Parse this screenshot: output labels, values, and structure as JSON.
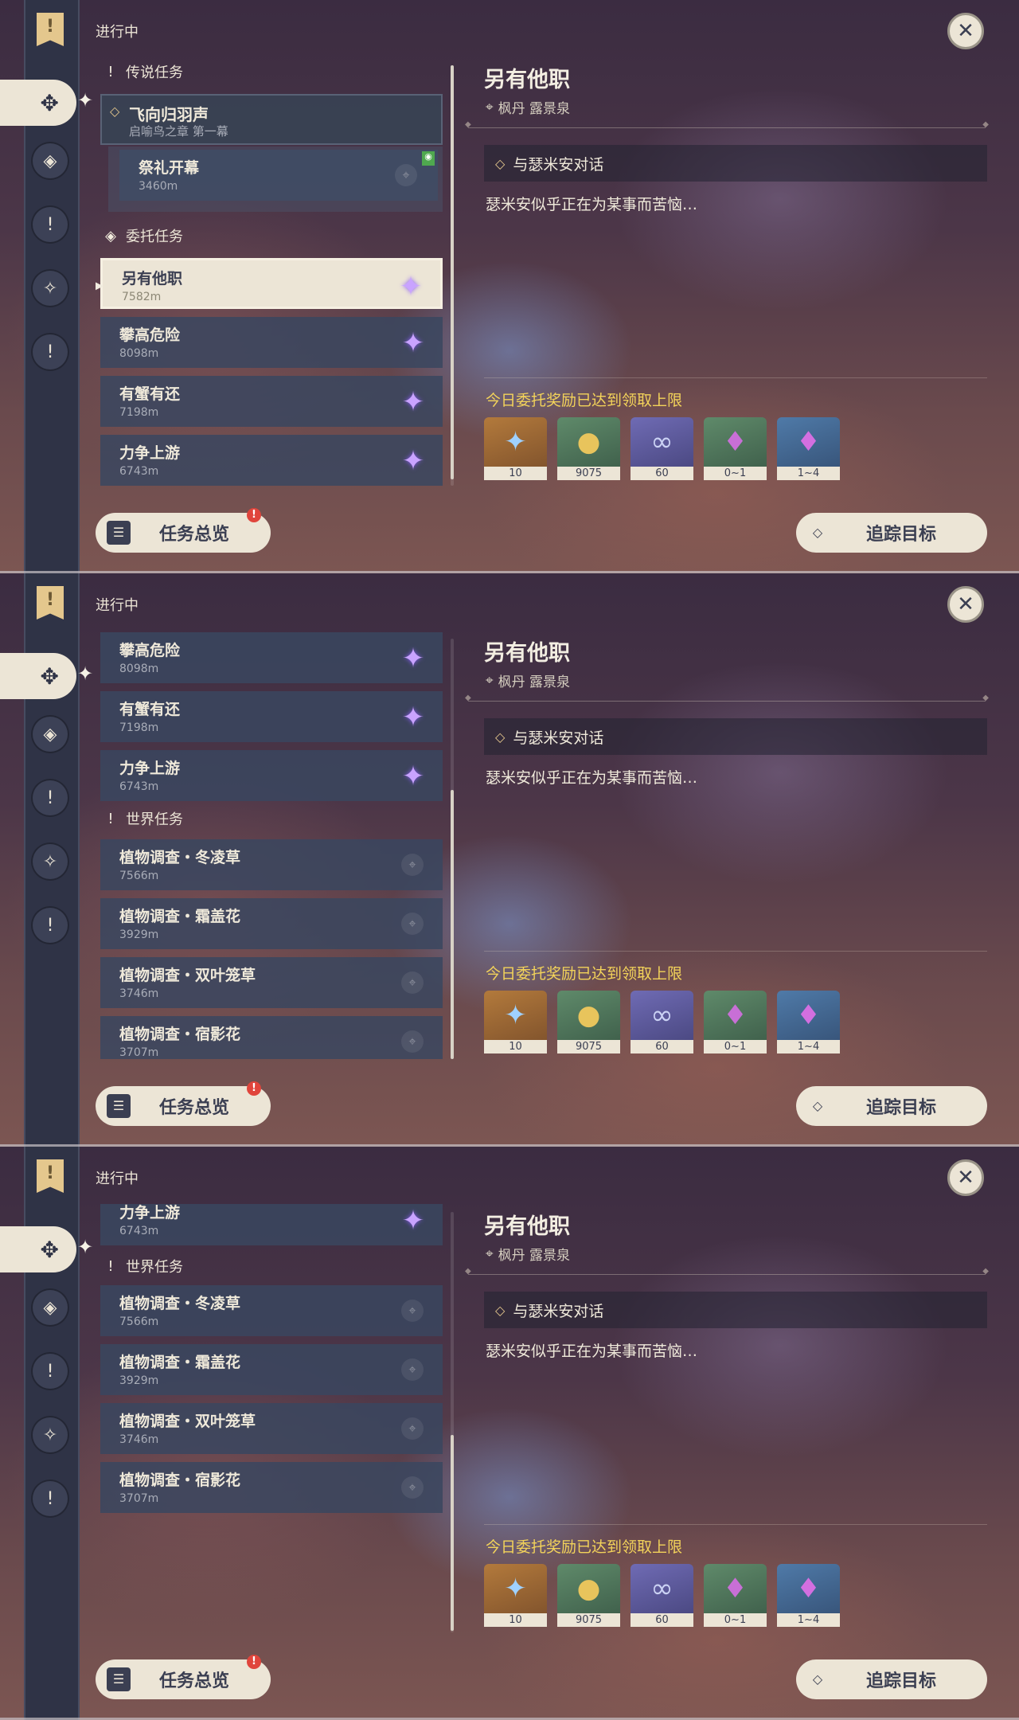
{
  "status": "进行中",
  "overview_label": "任务总览",
  "overview_badge": "!",
  "track_label": "追踪目标",
  "rail_icons": [
    "quest-banner-icon",
    "commission-icon",
    "archon-quest-icon",
    "world-quest-icon",
    "event-quest-icon",
    "exclamation-icon"
  ],
  "sections": {
    "legend": "传说任务",
    "commission": "委托任务",
    "world": "世界任务"
  },
  "legend_quest": {
    "name": "飞向归羽声",
    "chapter": "启喻鸟之章 第一幕",
    "sub": {
      "name": "祭礼开幕",
      "distance": "3460m"
    }
  },
  "commissions": [
    {
      "name": "另有他职",
      "distance": "7582m"
    },
    {
      "name": "攀高危险",
      "distance": "8098m"
    },
    {
      "name": "有蟹有还",
      "distance": "7198m"
    },
    {
      "name": "力争上游",
      "distance": "6743m"
    }
  ],
  "world_quests": [
    {
      "name": "植物调查・冬凌草",
      "distance": "7566m"
    },
    {
      "name": "植物调查・霜盖花",
      "distance": "3929m"
    },
    {
      "name": "植物调查・双叶笼草",
      "distance": "3746m"
    },
    {
      "name": "植物调查・宿影花",
      "distance": "3707m"
    }
  ],
  "detail": {
    "title": "另有他职",
    "location": "枫丹 露景泉",
    "objective": "与瑟米安对话",
    "description": "瑟米安似乎正在为某事而苦恼…",
    "reward_notice": "今日委托奖励已达到领取上限",
    "rewards": [
      {
        "icon": "adventure-exp-icon",
        "count": "10"
      },
      {
        "icon": "mora-icon",
        "count": "9075"
      },
      {
        "icon": "friendship-exp-icon",
        "count": "60"
      },
      {
        "icon": "crystal-fragment-icon",
        "count": "0~1"
      },
      {
        "icon": "crystal-chunk-icon",
        "count": "1~4"
      }
    ]
  },
  "colors": {
    "accent_cream": "#ece5d6",
    "reward_notice": "#f3d35a",
    "quest_star": "#c9a3ff",
    "badge_red": "#e0453c"
  }
}
